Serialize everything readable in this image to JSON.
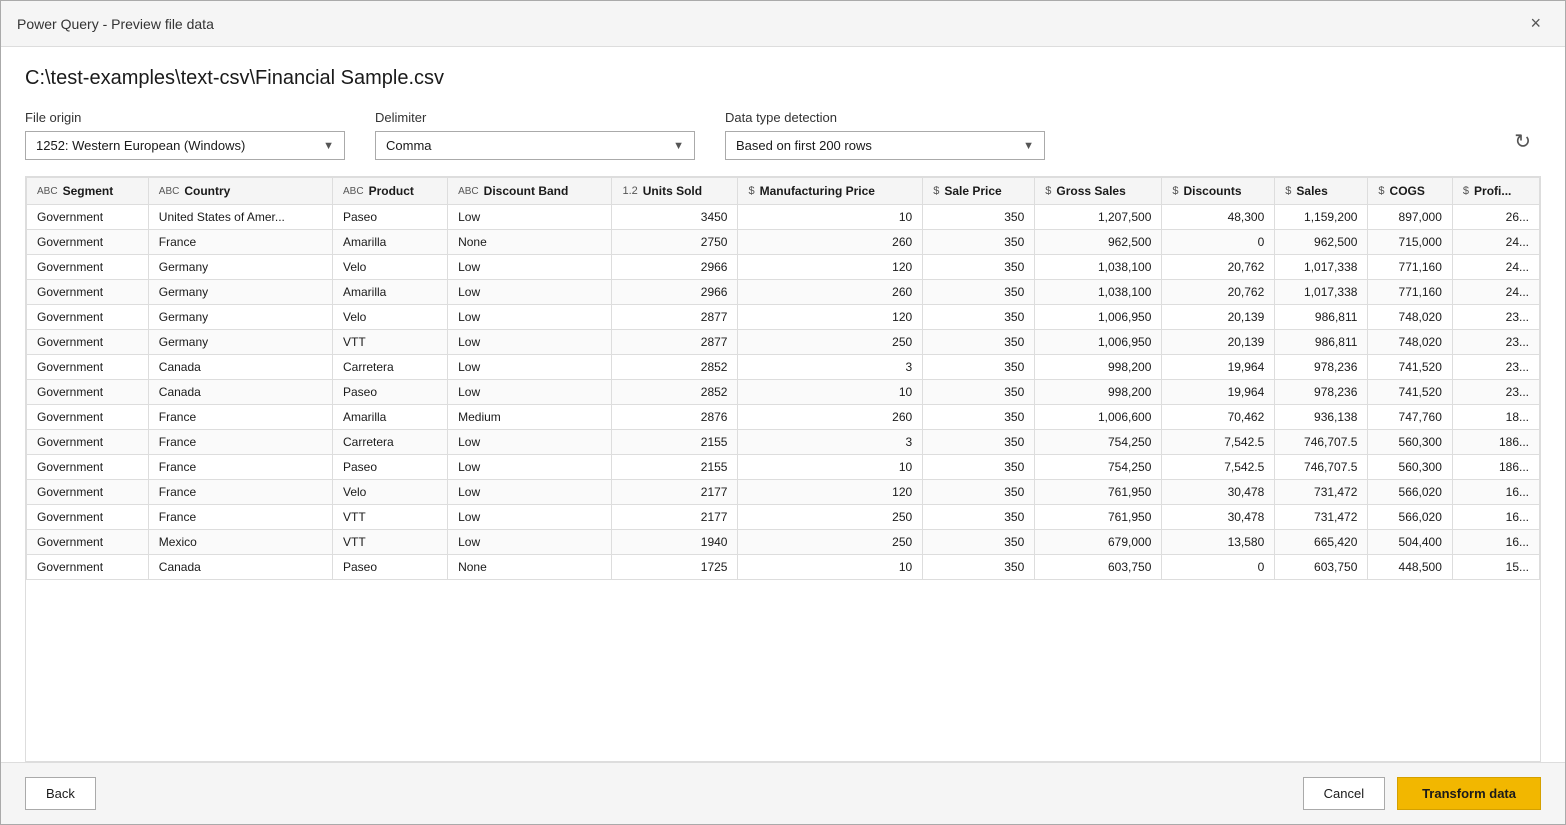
{
  "dialog": {
    "title": "Power Query - Preview file data",
    "close_label": "×"
  },
  "file_path": "C:\\test-examples\\text-csv\\Financial Sample.csv",
  "options": {
    "file_origin_label": "File origin",
    "file_origin_value": "1252: Western European (Windows)",
    "delimiter_label": "Delimiter",
    "delimiter_value": "Comma",
    "data_type_label": "Data type detection",
    "data_type_value": "Based on first 200 rows"
  },
  "table": {
    "columns": [
      {
        "name": "segment-col",
        "icon": "ABC",
        "label": "Segment"
      },
      {
        "name": "country-col",
        "icon": "ABC",
        "label": "Country"
      },
      {
        "name": "product-col",
        "icon": "ABC",
        "label": "Product"
      },
      {
        "name": "discount-band-col",
        "icon": "ABC",
        "label": "Discount Band"
      },
      {
        "name": "units-sold-col",
        "icon": "1.2",
        "label": "Units Sold"
      },
      {
        "name": "mfg-price-col",
        "icon": "$",
        "label": "Manufacturing Price"
      },
      {
        "name": "sale-price-col",
        "icon": "$",
        "label": "Sale Price"
      },
      {
        "name": "gross-sales-col",
        "icon": "$",
        "label": "Gross Sales"
      },
      {
        "name": "discounts-col",
        "icon": "$",
        "label": "Discounts"
      },
      {
        "name": "sales-col",
        "icon": "$",
        "label": "Sales"
      },
      {
        "name": "cogs-col",
        "icon": "$",
        "label": "COGS"
      },
      {
        "name": "profit-col",
        "icon": "$",
        "label": "Profi..."
      }
    ],
    "rows": [
      [
        "Government",
        "United States of Amer...",
        "Paseo",
        "Low",
        "3450",
        "10",
        "350",
        "1,207,500",
        "48,300",
        "1,159,200",
        "897,000",
        "26..."
      ],
      [
        "Government",
        "France",
        "Amarilla",
        "None",
        "2750",
        "260",
        "350",
        "962,500",
        "0",
        "962,500",
        "715,000",
        "24..."
      ],
      [
        "Government",
        "Germany",
        "Velo",
        "Low",
        "2966",
        "120",
        "350",
        "1,038,100",
        "20,762",
        "1,017,338",
        "771,160",
        "24..."
      ],
      [
        "Government",
        "Germany",
        "Amarilla",
        "Low",
        "2966",
        "260",
        "350",
        "1,038,100",
        "20,762",
        "1,017,338",
        "771,160",
        "24..."
      ],
      [
        "Government",
        "Germany",
        "Velo",
        "Low",
        "2877",
        "120",
        "350",
        "1,006,950",
        "20,139",
        "986,811",
        "748,020",
        "23..."
      ],
      [
        "Government",
        "Germany",
        "VTT",
        "Low",
        "2877",
        "250",
        "350",
        "1,006,950",
        "20,139",
        "986,811",
        "748,020",
        "23..."
      ],
      [
        "Government",
        "Canada",
        "Carretera",
        "Low",
        "2852",
        "3",
        "350",
        "998,200",
        "19,964",
        "978,236",
        "741,520",
        "23..."
      ],
      [
        "Government",
        "Canada",
        "Paseo",
        "Low",
        "2852",
        "10",
        "350",
        "998,200",
        "19,964",
        "978,236",
        "741,520",
        "23..."
      ],
      [
        "Government",
        "France",
        "Amarilla",
        "Medium",
        "2876",
        "260",
        "350",
        "1,006,600",
        "70,462",
        "936,138",
        "747,760",
        "18..."
      ],
      [
        "Government",
        "France",
        "Carretera",
        "Low",
        "2155",
        "3",
        "350",
        "754,250",
        "7,542.5",
        "746,707.5",
        "560,300",
        "186..."
      ],
      [
        "Government",
        "France",
        "Paseo",
        "Low",
        "2155",
        "10",
        "350",
        "754,250",
        "7,542.5",
        "746,707.5",
        "560,300",
        "186..."
      ],
      [
        "Government",
        "France",
        "Velo",
        "Low",
        "2177",
        "120",
        "350",
        "761,950",
        "30,478",
        "731,472",
        "566,020",
        "16..."
      ],
      [
        "Government",
        "France",
        "VTT",
        "Low",
        "2177",
        "250",
        "350",
        "761,950",
        "30,478",
        "731,472",
        "566,020",
        "16..."
      ],
      [
        "Government",
        "Mexico",
        "VTT",
        "Low",
        "1940",
        "250",
        "350",
        "679,000",
        "13,580",
        "665,420",
        "504,400",
        "16..."
      ],
      [
        "Government",
        "Canada",
        "Paseo",
        "None",
        "1725",
        "10",
        "350",
        "603,750",
        "0",
        "603,750",
        "448,500",
        "15..."
      ]
    ]
  },
  "footer": {
    "back_label": "Back",
    "cancel_label": "Cancel",
    "transform_label": "Transform data"
  }
}
